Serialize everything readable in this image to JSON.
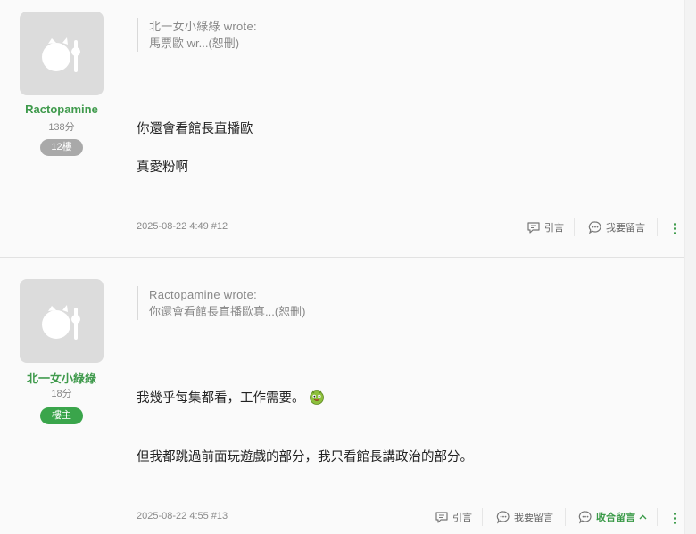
{
  "posts": [
    {
      "username": "Ractopamine",
      "score": "138分",
      "badge": "12樓",
      "quote": {
        "author_line": "北一女小綠綠 wrote:",
        "excerpt": "馬票歐 wr...(恕刪)"
      },
      "lines": [
        "你還會看館長直播歐",
        "真愛粉啊"
      ],
      "meta": "2025-08-22 4:49 #12",
      "actions": {
        "quote": "引言",
        "reply": "我要留言"
      }
    },
    {
      "username": "北一女小綠綠",
      "score": "18分",
      "badge": "樓主",
      "quote": {
        "author_line": "Ractopamine wrote:",
        "excerpt": "你還會看館長直播歐真...(恕刪)"
      },
      "lines": [
        "我幾乎每集都看，工作需要。",
        "但我都跳過前面玩遊戲的部分，我只看館長講政治的部分。"
      ],
      "meta": "2025-08-22 4:55 #13",
      "actions": {
        "quote": "引言",
        "reply": "我要留言",
        "collapse": "收合留言"
      }
    }
  ],
  "colors": {
    "accent": "#3a9a48",
    "op_badge": "#3aa54b",
    "floor_badge": "#a9a9a9",
    "avatar_bg": "#dcdcdc"
  },
  "icons": {
    "avatar": "default-avatar-icon",
    "quote": "quote-icon",
    "reply": "comment-bubble-icon",
    "more": "more-vertical-icon",
    "emoji": "smiley-emoji-icon"
  }
}
